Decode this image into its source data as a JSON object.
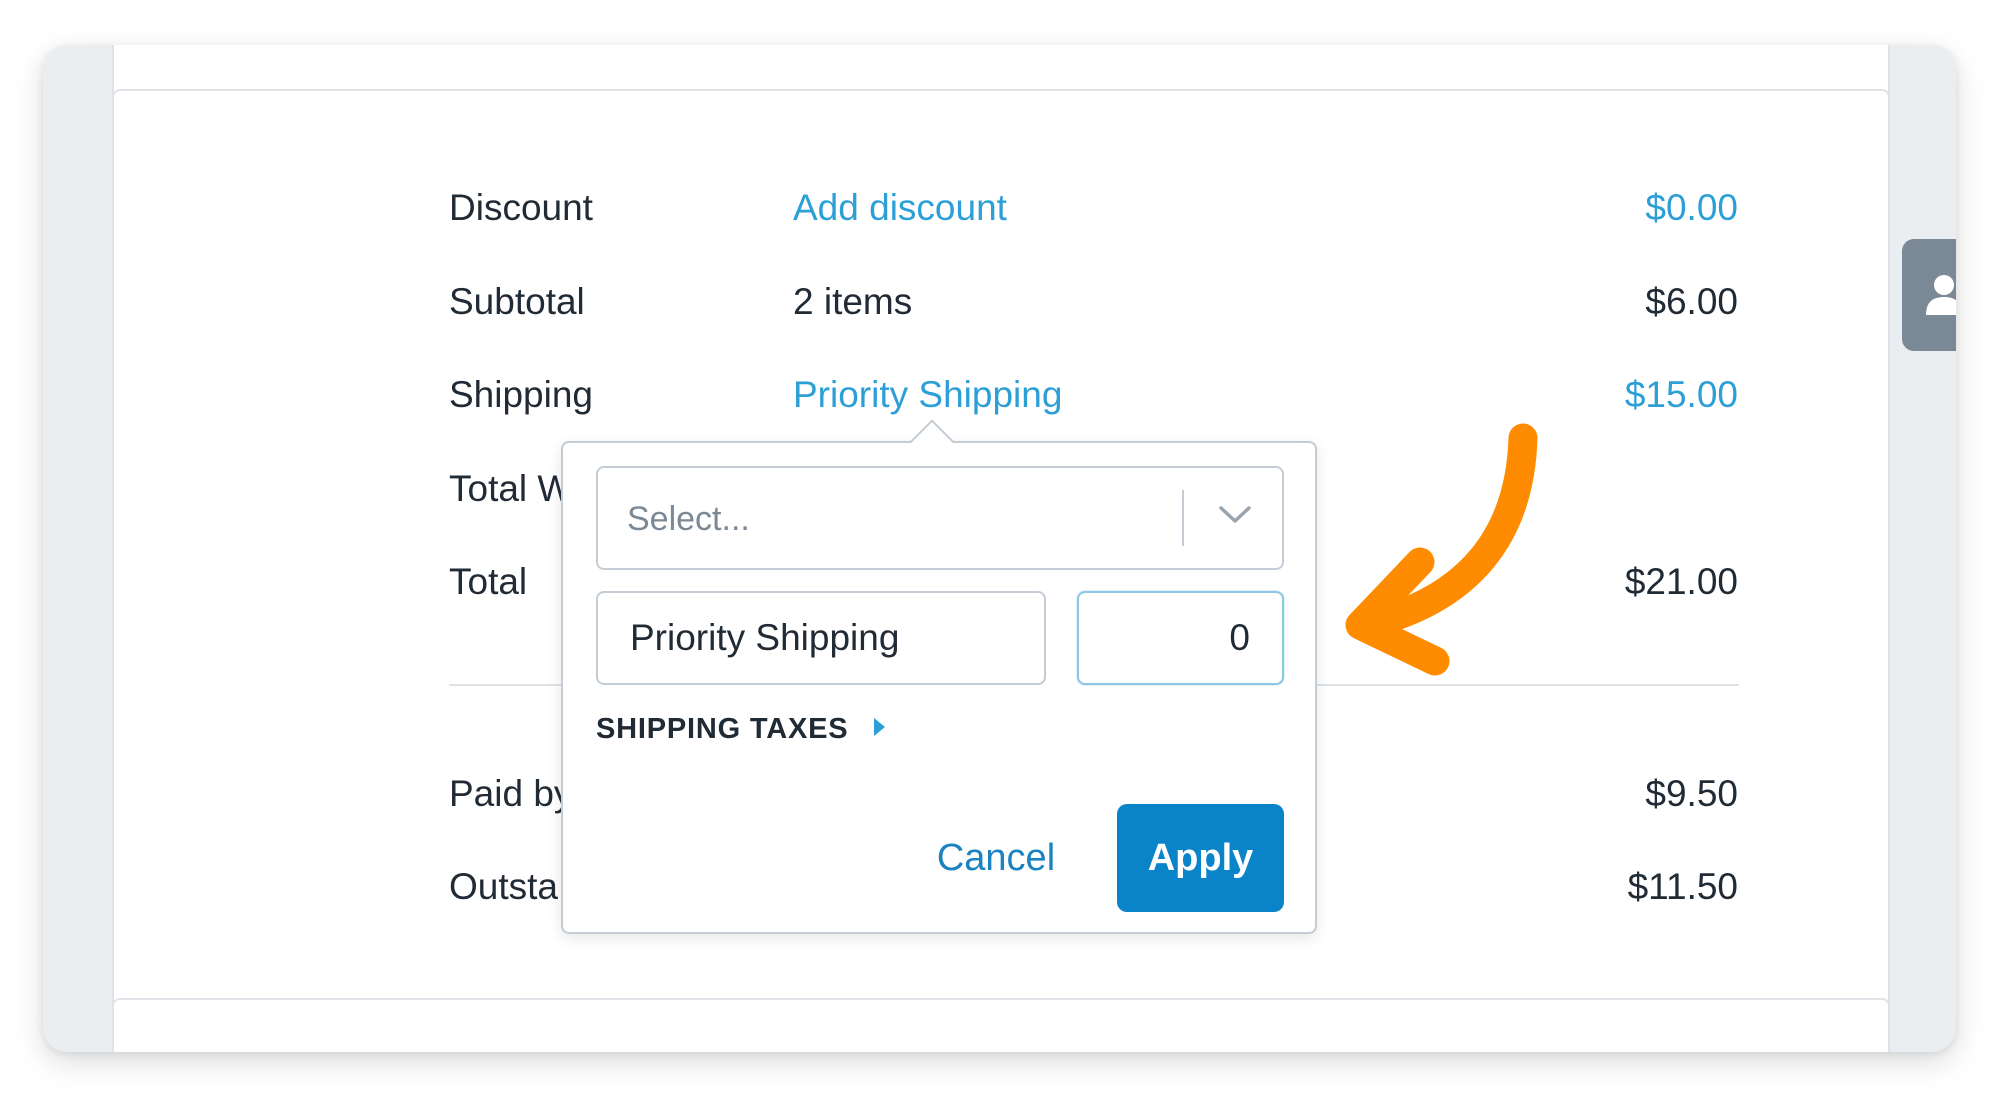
{
  "summary": {
    "rows": [
      {
        "label": "Discount",
        "mid": "Add discount",
        "amount": "$0.00"
      },
      {
        "label": "Subtotal",
        "mid": "2 items",
        "amount": "$6.00"
      },
      {
        "label": "Shipping",
        "mid": "Priority Shipping",
        "amount": "$15.00"
      },
      {
        "label": "Total W",
        "mid": "",
        "amount": ""
      },
      {
        "label": "Total",
        "mid": "",
        "amount": "$21.00"
      },
      {
        "label": "Paid by",
        "mid": "",
        "amount": "$9.50"
      },
      {
        "label": "Outsta",
        "mid": "",
        "amount": "$11.50"
      }
    ]
  },
  "popover": {
    "select_placeholder": "Select...",
    "shipping_name_value": "Priority Shipping",
    "shipping_price_value": "0",
    "taxes_label": "SHIPPING TAXES",
    "cancel_label": "Cancel",
    "apply_label": "Apply"
  },
  "colors": {
    "link": "#2c9fd6",
    "primary_button": "#0a84c9",
    "annotation_arrow": "#ff8c00",
    "frame_background": "#ebeef0"
  },
  "icons": {
    "side_tab": "user-icon",
    "select": "chevron-down-icon",
    "taxes": "caret-right-icon",
    "annotation": "curved-arrow-icon"
  }
}
